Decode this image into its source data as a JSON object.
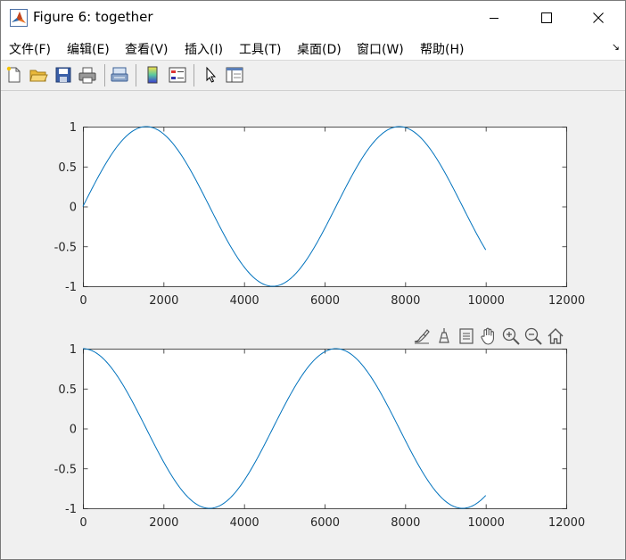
{
  "window": {
    "title": "Figure 6: together",
    "controls": [
      "minimize-icon",
      "maximize-icon",
      "close-icon"
    ]
  },
  "menu": {
    "items": [
      "文件(F)",
      "编辑(E)",
      "查看(V)",
      "插入(I)",
      "工具(T)",
      "桌面(D)",
      "窗口(W)",
      "帮助(H)"
    ],
    "overflow": "↘"
  },
  "toolbar": {
    "buttons": [
      "new-figure-icon",
      "open-file-icon",
      "save-icon",
      "print-icon",
      "link-plot-icon",
      "insert-colorbar-icon",
      "insert-legend-icon",
      "edit-plot-arrow-icon",
      "property-inspector-icon"
    ]
  },
  "axes_toolbar": {
    "buttons": [
      "brush-icon",
      "data-tips-icon",
      "export-icon",
      "pan-icon",
      "zoom-in-icon",
      "zoom-out-icon",
      "home-icon"
    ]
  },
  "colors": {
    "line": "#0072bd",
    "axes_bg": "#ffffff",
    "figure_bg": "#f0f0f0",
    "axis": "#262626"
  },
  "chart_data": [
    {
      "type": "line",
      "title": "",
      "xlabel": "",
      "ylabel": "",
      "xlim": [
        0,
        12000
      ],
      "ylim": [
        -1,
        1
      ],
      "xticks": [
        0,
        2000,
        4000,
        6000,
        8000,
        10000,
        12000
      ],
      "yticks": [
        -1,
        -0.5,
        0,
        0.5,
        1
      ],
      "xtick_labels": [
        "0",
        "2000",
        "4000",
        "6000",
        "8000",
        "10000",
        "12000"
      ],
      "ytick_labels": [
        "-1",
        "-0.5",
        "0",
        "0.5",
        "1"
      ],
      "grid": false,
      "series": [
        {
          "function": "sin(x/1000)",
          "x_start": 0,
          "x_end": 10000,
          "y_end": -0.544,
          "peaks_x": [
            1571,
            7854
          ],
          "troughs_x": [
            4712
          ]
        }
      ]
    },
    {
      "type": "line",
      "title": "",
      "xlabel": "",
      "ylabel": "",
      "xlim": [
        0,
        12000
      ],
      "ylim": [
        -1,
        1
      ],
      "xticks": [
        0,
        2000,
        4000,
        6000,
        8000,
        10000,
        12000
      ],
      "yticks": [
        -1,
        -0.5,
        0,
        0.5,
        1
      ],
      "xtick_labels": [
        "0",
        "2000",
        "4000",
        "6000",
        "8000",
        "10000",
        "12000"
      ],
      "ytick_labels": [
        "-1",
        "-0.5",
        "0",
        "0.5",
        "1"
      ],
      "grid": false,
      "series": [
        {
          "function": "cos(x/1000)",
          "x_start": 0,
          "x_end": 10000,
          "y_end": -0.839,
          "peaks_x": [
            0,
            6283
          ],
          "troughs_x": [
            3142,
            9425
          ]
        }
      ]
    }
  ]
}
